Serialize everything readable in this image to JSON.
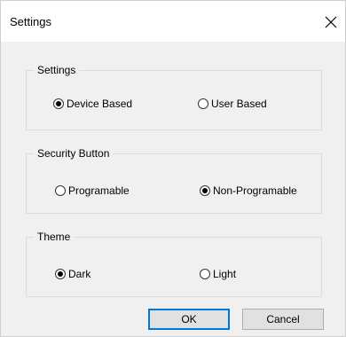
{
  "window": {
    "title": "Settings"
  },
  "groups": {
    "settings": {
      "label": "Settings",
      "options": [
        {
          "label": "Device Based",
          "selected": true
        },
        {
          "label": "User Based",
          "selected": false
        }
      ]
    },
    "security": {
      "label": "Security Button",
      "options": [
        {
          "label": "Programable",
          "selected": false
        },
        {
          "label": "Non-Programable",
          "selected": true
        }
      ]
    },
    "theme": {
      "label": "Theme",
      "options": [
        {
          "label": "Dark",
          "selected": true
        },
        {
          "label": "Light",
          "selected": false
        }
      ]
    }
  },
  "buttons": {
    "ok_label": "OK",
    "cancel_label": "Cancel"
  },
  "colors": {
    "dialog_background": "#f0f0f0",
    "titlebar_background": "#ffffff",
    "default_button_border": "#0078d7"
  },
  "icons": {
    "close": "close-icon"
  }
}
